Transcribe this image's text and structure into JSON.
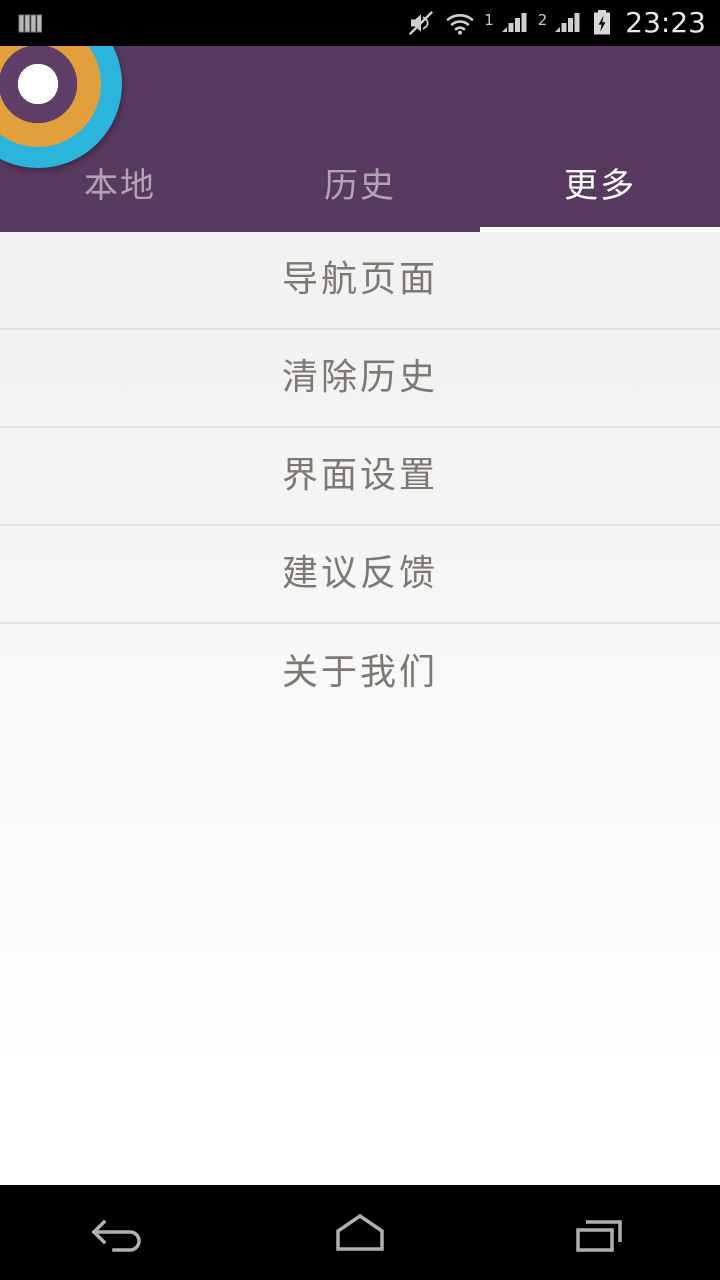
{
  "status_bar": {
    "left_icons": [
      "sim-card-icon"
    ],
    "right_icons": [
      "mute-icon",
      "wifi-icon",
      "signal-icon-1",
      "signal-icon-2",
      "battery-charging-icon"
    ],
    "sim1_label": "1",
    "sim2_label": "2",
    "clock": "23:23"
  },
  "header": {
    "logo_name": "app-logo",
    "background_color": "#583a60",
    "accent_colors": {
      "ring_orange": "#e2a03c",
      "ring_cyan": "#2cb5dc",
      "ring_purple": "#5f3e68",
      "ring_white": "#ffffff"
    },
    "tabs": [
      {
        "label": "本地",
        "active": false
      },
      {
        "label": "历史",
        "active": false
      },
      {
        "label": "更多",
        "active": true
      }
    ],
    "active_tab_index": 2,
    "active_tab_color": "#ffffff",
    "inactive_tab_color": "#b3a3b8"
  },
  "content": {
    "text_color": "#7d7871",
    "menu_items": [
      {
        "label": "导航页面"
      },
      {
        "label": "清除历史"
      },
      {
        "label": "界面设置"
      },
      {
        "label": "建议反馈"
      },
      {
        "label": "关于我们"
      }
    ]
  },
  "nav_bar": {
    "buttons": [
      {
        "name": "back-icon"
      },
      {
        "name": "home-icon"
      },
      {
        "name": "recents-icon"
      }
    ]
  }
}
